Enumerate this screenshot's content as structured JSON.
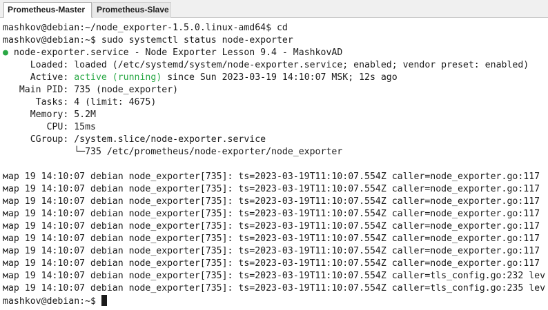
{
  "tabs": [
    {
      "label": "Prometheus-Master",
      "active": true
    },
    {
      "label": "Prometheus-Slave",
      "active": false
    }
  ],
  "terminal": {
    "prompt1": "mashkov@debian:~/node_exporter-1.5.0.linux-amd64$",
    "cmd1": " cd",
    "prompt2": "mashkov@debian:~$",
    "cmd2": " sudo systemctl status node-exporter",
    "service_bullet": "●",
    "service_line": " node-exporter.service - Node Exporter Lesson 9.4 - MashkovAD",
    "loaded_label": "     Loaded:",
    "loaded_value": " loaded (/etc/systemd/system/node-exporter.service; enabled; vendor preset: enabled)",
    "active_label": "     Active:",
    "active_status": " active (running)",
    "active_rest": " since Sun 2023-03-19 14:10:07 MSK; 12s ago",
    "mainpid_label": "   Main PID:",
    "mainpid_value": " 735 (node_exporter)",
    "tasks_label": "      Tasks:",
    "tasks_value": " 4 (limit: 4675)",
    "memory_label": "     Memory:",
    "memory_value": " 5.2M",
    "cpu_label": "        CPU:",
    "cpu_value": " 15ms",
    "cgroup_label": "     CGroup:",
    "cgroup_value": " /system.slice/node-exporter.service",
    "cgroup_tree": "             └─735 /etc/prometheus/node-exporter/node_exporter",
    "log_lines": [
      "мар 19 14:10:07 debian node_exporter[735]: ts=2023-03-19T11:10:07.554Z caller=node_exporter.go:117",
      "мар 19 14:10:07 debian node_exporter[735]: ts=2023-03-19T11:10:07.554Z caller=node_exporter.go:117",
      "мар 19 14:10:07 debian node_exporter[735]: ts=2023-03-19T11:10:07.554Z caller=node_exporter.go:117",
      "мар 19 14:10:07 debian node_exporter[735]: ts=2023-03-19T11:10:07.554Z caller=node_exporter.go:117",
      "мар 19 14:10:07 debian node_exporter[735]: ts=2023-03-19T11:10:07.554Z caller=node_exporter.go:117",
      "мар 19 14:10:07 debian node_exporter[735]: ts=2023-03-19T11:10:07.554Z caller=node_exporter.go:117",
      "мар 19 14:10:07 debian node_exporter[735]: ts=2023-03-19T11:10:07.554Z caller=node_exporter.go:117",
      "мар 19 14:10:07 debian node_exporter[735]: ts=2023-03-19T11:10:07.554Z caller=node_exporter.go:117",
      "мар 19 14:10:07 debian node_exporter[735]: ts=2023-03-19T11:10:07.554Z caller=tls_config.go:232 lev",
      "мар 19 14:10:07 debian node_exporter[735]: ts=2023-03-19T11:10:07.554Z caller=tls_config.go:235 lev"
    ],
    "final_prompt": "mashkov@debian:~$",
    "final_input": " "
  },
  "colors": {
    "status_green": "#2aa845",
    "text": "#1a1a1a",
    "background": "#ffffff"
  }
}
